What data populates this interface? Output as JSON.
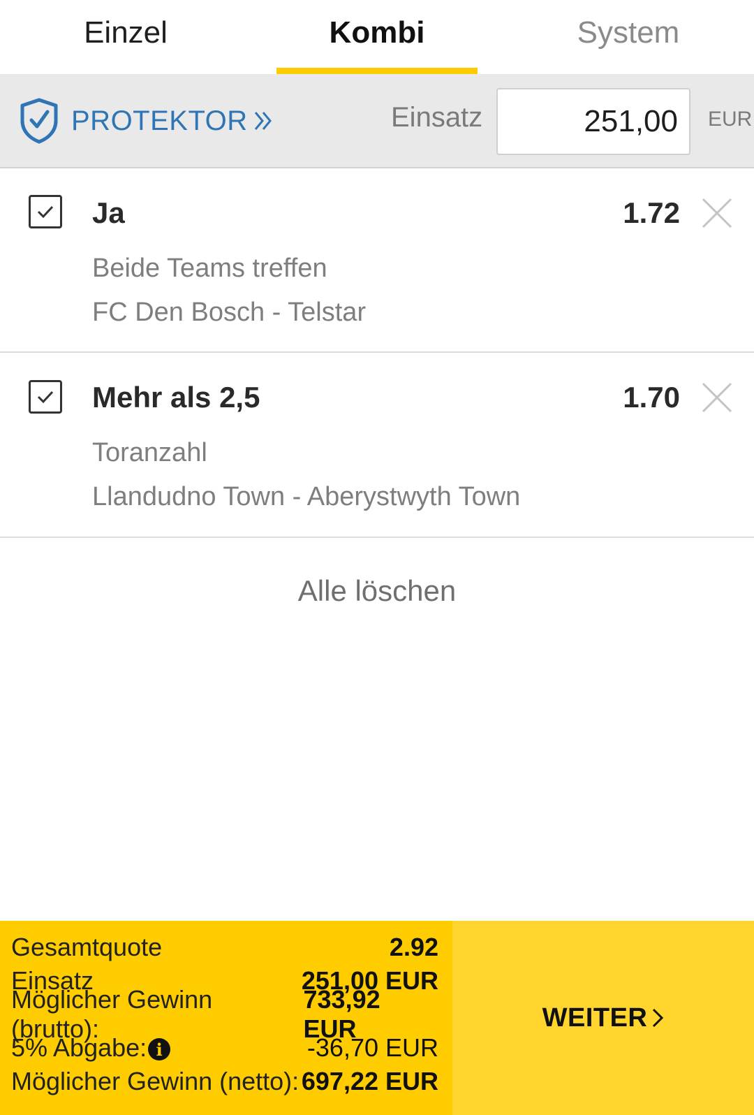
{
  "tabs": [
    {
      "label": "Einzel"
    },
    {
      "label": "Kombi"
    },
    {
      "label": "System"
    }
  ],
  "active_tab": "Kombi",
  "stake_bar": {
    "protektor_label": "PROTEKTOR",
    "einsatz_label": "Einsatz",
    "stake_value": "251,00",
    "currency": "EUR"
  },
  "bets": [
    {
      "selected": true,
      "title": "Ja",
      "odds": "1.72",
      "market": "Beide Teams treffen",
      "match": "FC Den Bosch - Telstar"
    },
    {
      "selected": true,
      "title": "Mehr als 2,5",
      "odds": "1.70",
      "market": "Toranzahl",
      "match": "Llandudno Town - Aberystwyth Town"
    }
  ],
  "clear_all_label": "Alle löschen",
  "summary": {
    "rows": [
      {
        "label": "Gesamtquote",
        "value": "2.92"
      },
      {
        "label": "Einsatz",
        "value": "251,00 EUR"
      },
      {
        "label": "Möglicher Gewinn (brutto):",
        "value": "733,92 EUR"
      },
      {
        "label": "5% Abgabe:",
        "value": "-36,70 EUR"
      },
      {
        "label": "Möglicher Gewinn (netto):",
        "value": "697,22 EUR"
      }
    ]
  },
  "next_label": "WEITER",
  "colors": {
    "accent_yellow": "#ffcc00",
    "button_yellow": "#ffd52e",
    "protektor_blue": "#2f75b5",
    "bar_grey": "#e9e9e9"
  },
  "icons": [
    "shield-check-icon",
    "double-chevron-right-icon",
    "checkbox-checked-icon",
    "close-icon",
    "info-icon",
    "chevron-right-icon"
  ]
}
